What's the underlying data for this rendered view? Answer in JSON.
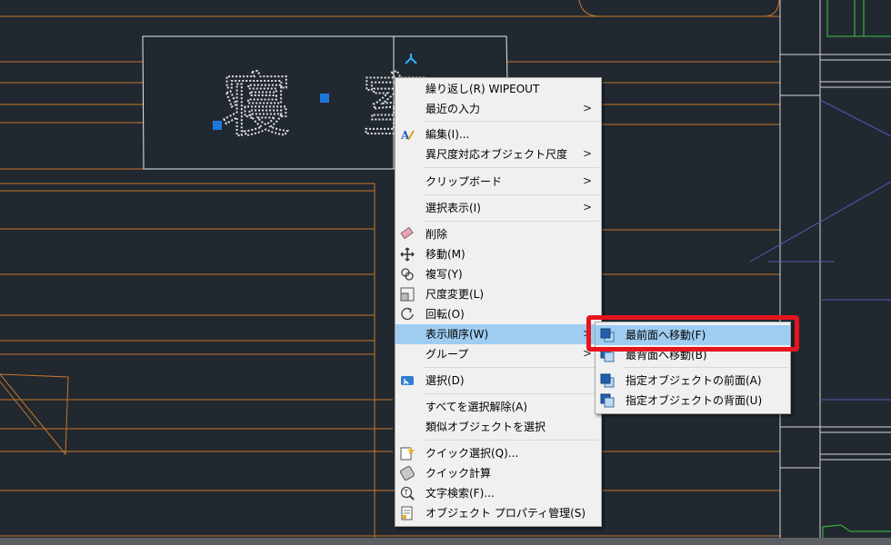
{
  "drawing": {
    "room_label_char1": "寝",
    "room_label_char2": "室"
  },
  "context_menu": {
    "items": [
      {
        "label": "繰り返し(R) WIPEOUT"
      },
      {
        "label": "最近の入力"
      },
      {
        "label": "編集(I)..."
      },
      {
        "label": "異尺度対応オブジェクト尺度"
      },
      {
        "label": "クリップボード"
      },
      {
        "label": "選択表示(I)"
      },
      {
        "label": "削除"
      },
      {
        "label": "移動(M)"
      },
      {
        "label": "複写(Y)"
      },
      {
        "label": "尺度変更(L)"
      },
      {
        "label": "回転(O)"
      },
      {
        "label": "表示順序(W)"
      },
      {
        "label": "グループ"
      },
      {
        "label": "選択(D)"
      },
      {
        "label": "すべてを選択解除(A)"
      },
      {
        "label": "類似オブジェクトを選択"
      },
      {
        "label": "クイック選択(Q)..."
      },
      {
        "label": "クイック計算"
      },
      {
        "label": "文字検索(F)..."
      },
      {
        "label": "オブジェクト プロパティ管理(S)"
      }
    ]
  },
  "draw_order_submenu": {
    "items": [
      {
        "label": "最前面へ移動(F)"
      },
      {
        "label": "最背面へ移動(B)"
      },
      {
        "label": "指定オブジェクトの前面(A)"
      },
      {
        "label": "指定オブジェクトの背面(U)"
      }
    ]
  },
  "colors": {
    "canvas_bg": "#212830",
    "wall_line": "#c8782c",
    "highlight": "#9fcdf2",
    "callout": "#e6141e",
    "grip": "#1e78dc",
    "green_geometry": "#3cc83c",
    "blue_geometry": "#5a5ab4"
  }
}
